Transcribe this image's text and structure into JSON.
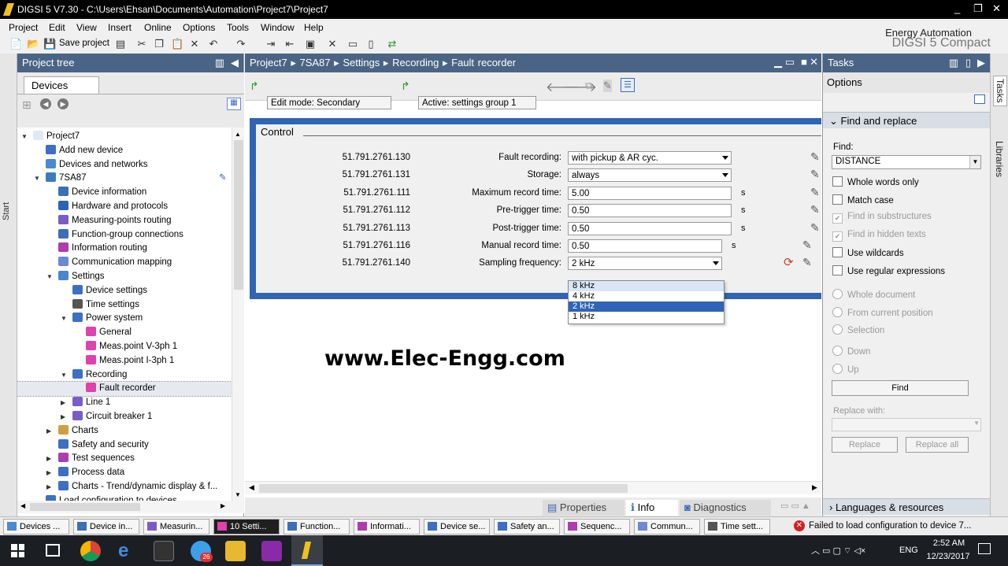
{
  "window": {
    "title": "DIGSI 5 V7.30 - C:\\Users\\Ehsan\\Documents\\Automation\\Project7\\Project7",
    "min": "_",
    "max": "❐",
    "close": "✕"
  },
  "menu": [
    "Project",
    "Edit",
    "View",
    "Insert",
    "Online",
    "Options",
    "Tools",
    "Window",
    "Help"
  ],
  "toolbar": {
    "save_label": "Save project"
  },
  "brand": {
    "line1": "Energy Automation",
    "line2": "DIGSI 5 Compact"
  },
  "start_tab": "Start",
  "project_tree": {
    "title": "Project tree",
    "devices_tab": "Devices",
    "items": [
      {
        "label": "Project7",
        "level": 0,
        "arrow": "▼",
        "color": "#dfe8f5"
      },
      {
        "label": "Add new device",
        "level": 1,
        "arrow": "",
        "color": "#3c6fc6"
      },
      {
        "label": "Devices and networks",
        "level": 1,
        "arrow": "",
        "color": "#4a8ad0"
      },
      {
        "label": "7SA87",
        "level": 1,
        "arrow": "▼",
        "color": "#3c7bc0"
      },
      {
        "label": "Device information",
        "level": 2,
        "arrow": "",
        "color": "#3b6fb8"
      },
      {
        "label": "Hardware and protocols",
        "level": 2,
        "arrow": "",
        "color": "#2a64b8"
      },
      {
        "label": "Measuring-points routing",
        "level": 2,
        "arrow": "",
        "color": "#7a5cc8"
      },
      {
        "label": "Function-group connections",
        "level": 2,
        "arrow": "",
        "color": "#3b6fb8"
      },
      {
        "label": "Information routing",
        "level": 2,
        "arrow": "",
        "color": "#b03ab0"
      },
      {
        "label": "Communication mapping",
        "level": 2,
        "arrow": "",
        "color": "#6a8ad8"
      },
      {
        "label": "Settings",
        "level": 2,
        "arrow": "▼",
        "color": "#4a86d0"
      },
      {
        "label": "Device settings",
        "level": 3,
        "arrow": "",
        "color": "#3c6fc6"
      },
      {
        "label": "Time settings",
        "level": 3,
        "arrow": "",
        "color": "#555"
      },
      {
        "label": "Power system",
        "level": 3,
        "arrow": "▼",
        "color": "#3c6fc6"
      },
      {
        "label": "General",
        "level": 4,
        "arrow": "",
        "color": "#e040b0"
      },
      {
        "label": "Meas.point V-3ph 1",
        "level": 4,
        "arrow": "",
        "color": "#e040b0"
      },
      {
        "label": "Meas.point I-3ph 1",
        "level": 4,
        "arrow": "",
        "color": "#e040b0"
      },
      {
        "label": "Recording",
        "level": 3,
        "arrow": "▼",
        "color": "#3c6fc6"
      },
      {
        "label": "Fault recorder",
        "level": 4,
        "arrow": "",
        "color": "#e040b0",
        "selected": true
      },
      {
        "label": "Line 1",
        "level": 3,
        "arrow": "▶",
        "color": "#7a5cc8"
      },
      {
        "label": "Circuit breaker 1",
        "level": 3,
        "arrow": "▶",
        "color": "#7a5cc8"
      },
      {
        "label": "Charts",
        "level": 2,
        "arrow": "▶",
        "color": "#d0a040"
      },
      {
        "label": "Safety and security",
        "level": 2,
        "arrow": "",
        "color": "#3c6fc6"
      },
      {
        "label": "Test sequences",
        "level": 2,
        "arrow": "▶",
        "color": "#b03ab0"
      },
      {
        "label": "Process data",
        "level": 2,
        "arrow": "▶",
        "color": "#3c6fc6"
      },
      {
        "label": "Charts - Trend/dynamic display & f...",
        "level": 2,
        "arrow": "▶",
        "color": "#3c6fc6"
      },
      {
        "label": "Load configuration to devices",
        "level": 1,
        "arrow": "",
        "color": "#3c6fc6"
      }
    ]
  },
  "breadcrumb": {
    "p1": "Project7",
    "p2": "7SA87",
    "p3": "Settings",
    "p4": "Recording",
    "p5": "Fault recorder",
    "sep": "▸"
  },
  "edit": {
    "mode": "Edit mode:  Secondary",
    "active": "Active:  settings group 1"
  },
  "control": {
    "title": "Control",
    "rows": [
      {
        "id": "51.791.2761.130",
        "label": "Fault recording:",
        "value": "with pickup & AR cyc.",
        "unit": "",
        "dropdown": true
      },
      {
        "id": "51.791.2761.131",
        "label": "Storage:",
        "value": "always",
        "unit": "",
        "dropdown": true
      },
      {
        "id": "51.791.2761.111",
        "label": "Maximum record time:",
        "value": "5.00",
        "unit": "s",
        "dropdown": false
      },
      {
        "id": "51.791.2761.112",
        "label": "Pre-trigger time:",
        "value": "0.50",
        "unit": "s",
        "dropdown": false
      },
      {
        "id": "51.791.2761.113",
        "label": "Post-trigger time:",
        "value": "0.50",
        "unit": "s",
        "dropdown": false
      },
      {
        "id": "51.791.2761.116",
        "label": "Manual record time:",
        "value": "0.50",
        "unit": "s",
        "dropdown": false
      },
      {
        "id": "51.791.2761.140",
        "label": "Sampling frequency:",
        "value": "2 kHz",
        "unit": "",
        "dropdown": true
      }
    ],
    "options": [
      "8 kHz",
      "4 kHz",
      "2 kHz",
      "1 kHz"
    ],
    "selected_option": "2 kHz"
  },
  "watermark": "www.Elec-Engg.com",
  "bottom_tabs": {
    "properties": "Properties",
    "info": "Info",
    "diagnostics": "Diagnostics"
  },
  "tasks": {
    "title": "Tasks",
    "options": "Options",
    "find_replace": "Find and replace",
    "find_label": "Find:",
    "find_value": "DISTANCE",
    "checks": [
      {
        "label": "Whole words only",
        "checked": false,
        "disabled": false
      },
      {
        "label": "Match case",
        "checked": false,
        "disabled": false
      },
      {
        "label": "Find in substructures",
        "checked": true,
        "disabled": true
      },
      {
        "label": "Find in hidden texts",
        "checked": true,
        "disabled": true
      },
      {
        "label": "Use wildcards",
        "checked": false,
        "disabled": false
      },
      {
        "label": "Use regular expressions",
        "checked": false,
        "disabled": false
      }
    ],
    "scope": [
      "Whole document",
      "From current position",
      "Selection"
    ],
    "direction": [
      "Down",
      "Up"
    ],
    "find_button": "Find",
    "replace_label": "Replace with:",
    "replace_button": "Replace",
    "replace_all_button": "Replace all",
    "languages": "Languages & resources",
    "vtab_tasks": "Tasks",
    "vtab_libraries": "Libraries"
  },
  "status_tabs": [
    {
      "label": "Devices ...",
      "color": "#4a8ad0"
    },
    {
      "label": "Device in...",
      "color": "#3b6fb8"
    },
    {
      "label": "Measurin...",
      "color": "#7a5cc8"
    },
    {
      "label": "10 Setti...",
      "color": "#e040b0",
      "active": true
    },
    {
      "label": "Function...",
      "color": "#3b6fb8"
    },
    {
      "label": "Informati...",
      "color": "#b03ab0"
    },
    {
      "label": "Device se...",
      "color": "#3c6fc6"
    },
    {
      "label": "Safety an...",
      "color": "#3c6fc6"
    },
    {
      "label": "Sequenc...",
      "color": "#b03ab0"
    },
    {
      "label": "Commun...",
      "color": "#6a8ad8"
    },
    {
      "label": "Time sett...",
      "color": "#555"
    }
  ],
  "status_message": "Failed to load configuration to device 7...",
  "taskbar": {
    "lang": "ENG",
    "time": "2:52 AM",
    "date": "12/23/2017",
    "badge": "26"
  }
}
